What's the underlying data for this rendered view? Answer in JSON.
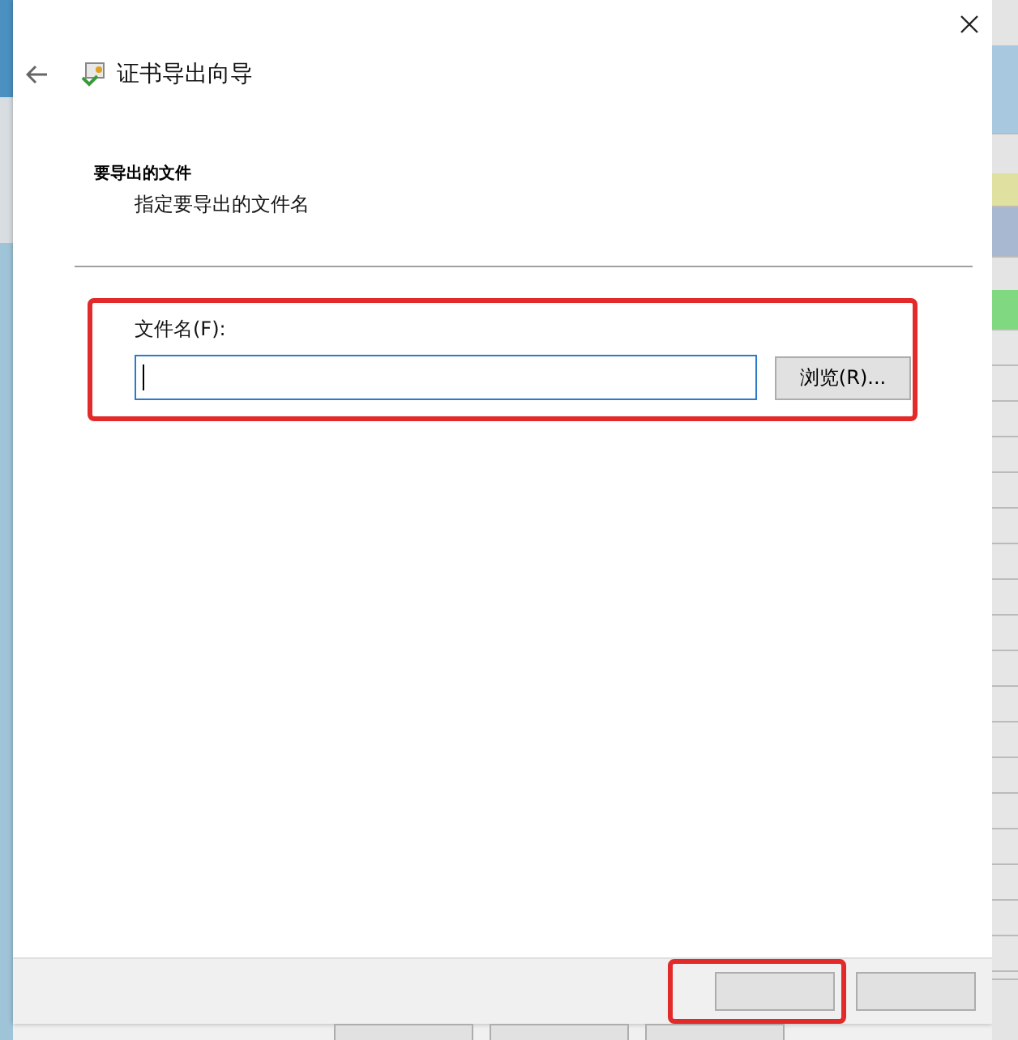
{
  "window": {
    "title": "证书导出向导"
  },
  "page": {
    "heading": "要导出的文件",
    "description": "指定要导出的文件名"
  },
  "file_field": {
    "label": "文件名(F):",
    "focused": true
  },
  "browse_button": {
    "label": "浏览(R)..."
  }
}
